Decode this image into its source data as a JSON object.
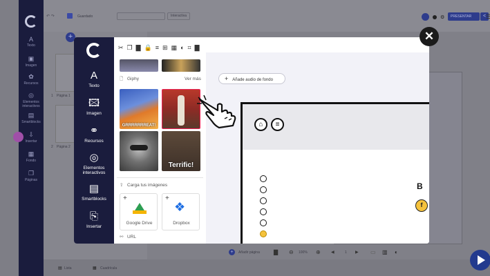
{
  "background_app": {
    "status": "Guardado",
    "header_input_label": "Interactiva",
    "present_label": "PRESENTAR",
    "sidebar": [
      "Texto",
      "Imagen",
      "Recursos",
      "Elementos interactivos",
      "Smartblocks",
      "Insertar",
      "Fondo",
      "Páginas"
    ],
    "pages": [
      {
        "number": "1",
        "label": "Página 1"
      },
      {
        "number": "2",
        "label": "Página 2"
      }
    ],
    "bottom_toolbar": {
      "add_page": "Añadir página",
      "zoom": "100%",
      "page_indicator": "1"
    },
    "view_tabs": {
      "list": "Lista",
      "grid": "Cuadrícula"
    }
  },
  "modal": {
    "sidebar_items": [
      {
        "label": "Texto",
        "icon": "text-icon"
      },
      {
        "label": "Imagen",
        "icon": "image-icon"
      },
      {
        "label": "Recursos",
        "icon": "resources-icon"
      },
      {
        "label": "Elementos interactivos",
        "icon": "interactive-icon"
      },
      {
        "label": "Smartblocks",
        "icon": "smartblocks-icon"
      },
      {
        "label": "Insertar",
        "icon": "insert-icon"
      }
    ],
    "giphy_label": "Giphy",
    "see_more": "Ver más",
    "gif_tiles": [
      {
        "name": "tiger-gif",
        "caption": "GRRRRRRREAT!"
      },
      {
        "name": "dance-gif",
        "caption": ""
      },
      {
        "name": "raccoon-gif",
        "caption": ""
      },
      {
        "name": "terrific-gif",
        "caption": "Terrific!"
      }
    ],
    "upload_label": "Carga tus imágenes",
    "cloud_sources": [
      {
        "label": "Google Drive",
        "icon": "google-drive-icon"
      },
      {
        "label": "Dropbox",
        "icon": "dropbox-icon"
      }
    ],
    "url_label": "URL",
    "audio_button": "Añade audio de fondo",
    "slide": {
      "letter": "B",
      "badge_letter": "f"
    },
    "colors": {
      "sidebar": "#1a1c3d",
      "accent": "#f5c23c",
      "overlay": "#7e7e86"
    }
  }
}
